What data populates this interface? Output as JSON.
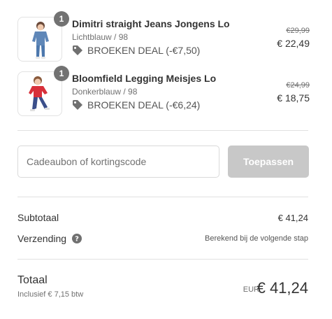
{
  "items": [
    {
      "quantity": "1",
      "name": "Dimitri straight Jeans Jongens Lo",
      "variant": "Lichtblauw / 98",
      "deal": "BROEKEN DEAL (-€7,50)",
      "original_price": "€29,99",
      "price": "€ 22,49"
    },
    {
      "quantity": "1",
      "name": "Bloomfield Legging Meisjes Lo",
      "variant": "Donkerblauw / 98",
      "deal": "BROEKEN DEAL (-€6,24)",
      "original_price": "€24,99",
      "price": "€ 18,75"
    }
  ],
  "discount": {
    "placeholder": "Cadeaubon of kortingscode",
    "apply_label": "Toepassen"
  },
  "summary": {
    "subtotal_label": "Subtotaal",
    "subtotal_value": "€ 41,24",
    "shipping_label": "Verzending",
    "shipping_value": "Berekend bij de volgende stap",
    "total_label": "Totaal",
    "tax_note": "Inclusief € 7,15 btw",
    "currency": "EUR",
    "total_value": "€ 41,24"
  },
  "icons": {
    "tag": "tag-icon",
    "help": "help-icon"
  }
}
